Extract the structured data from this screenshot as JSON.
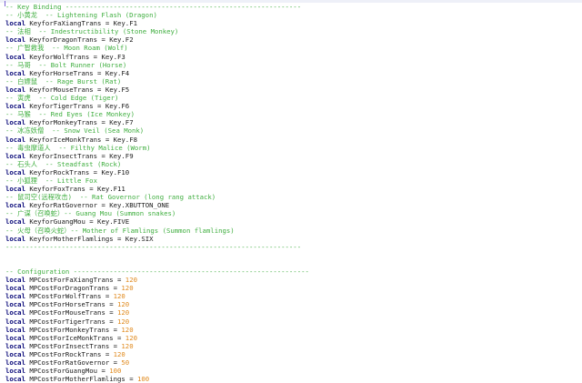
{
  "editor": {
    "key_binding": {
      "header": "-- Key Binding -----------------------------------------------------------",
      "entries": [
        {
          "comment": "-- 小黄龙  -- Lightening Flash (Dragon)",
          "keyword": "local",
          "code": " KeyforFaXiangTrans = Key.F1"
        },
        {
          "comment": "-- 法相  -- Indestructibility (Stone Monkey)",
          "keyword": "local",
          "code": " KeyforDragonTrans = Key.F2"
        },
        {
          "comment": "-- 广智救我  -- Moon Roam (Wolf)",
          "keyword": "local",
          "code": " KeyforWolfTrans = Key.F3"
        },
        {
          "comment": "-- 马哥  -- Bolt Runner (Horse)",
          "keyword": "local",
          "code": " KeyforHorseTrans = Key.F4"
        },
        {
          "comment": "-- 白嫖鼠  -- Rage Burst (Rat)",
          "keyword": "local",
          "code": " KeyforMouseTrans = Key.F5"
        },
        {
          "comment": "-- 寅虎  -- Cold Edge (Tiger)",
          "keyword": "local",
          "code": " KeyforTigerTrans = Key.F6"
        },
        {
          "comment": "-- 马猴  -- Red Eyes (Ice Monkey)",
          "keyword": "local",
          "code": " KeyforMonkeyTrans = Key.F7"
        },
        {
          "comment": "-- 冰冻妖僧  -- Snow Veil (Sea Monk)",
          "keyword": "local",
          "code": " KeyforIceMonkTrans = Key.F8"
        },
        {
          "comment": "-- 毒虫摩道人  -- Filthy Malice (Worm)",
          "keyword": "local",
          "code": " KeyforInsectTrans = Key.F9"
        },
        {
          "comment": "-- 石头人  -- Steadfast (Rock)",
          "keyword": "local",
          "code": " KeyforRockTrans = Key.F10"
        },
        {
          "comment": "-- 小狐狸  -- Little Fox",
          "keyword": "local",
          "code": " KeyforFoxTrans = Key.F11"
        },
        {
          "comment": "-- 鼠司空(远程攻击)  -- Rat Governor (long rang attack)",
          "keyword": "local",
          "code": " KeyforRatGovernor = Key.XBUTTON_ONE"
        },
        {
          "comment": "-- 广谋（召唤蛇）-- Guang Mou (Summon snakes)",
          "keyword": "local",
          "code": " KeyforGuangMou = Key.FIVE"
        },
        {
          "comment": "-- 火母（召唤火蛇）-- Mother of Flamlings (Summon flamlings)",
          "keyword": "local",
          "code": " KeyforMotherFlamlings = Key.SIX"
        }
      ],
      "footer": "--------------------------------------------------------------------------"
    },
    "configuration": {
      "header": "-- Configuration -----------------------------------------------------------",
      "entries": [
        {
          "keyword": "local",
          "name": " MPCostForFaXiangTrans = ",
          "value": "120"
        },
        {
          "keyword": "local",
          "name": " MPCostForDragonTrans = ",
          "value": "120"
        },
        {
          "keyword": "local",
          "name": " MPCostForWolfTrans = ",
          "value": "120"
        },
        {
          "keyword": "local",
          "name": " MPCostForHorseTrans = ",
          "value": "120"
        },
        {
          "keyword": "local",
          "name": " MPCostForMouseTrans = ",
          "value": "120"
        },
        {
          "keyword": "local",
          "name": " MPCostForTigerTrans = ",
          "value": "120"
        },
        {
          "keyword": "local",
          "name": " MPCostForMonkeyTrans = ",
          "value": "120"
        },
        {
          "keyword": "local",
          "name": " MPCostForIceMonkTrans = ",
          "value": "120"
        },
        {
          "keyword": "local",
          "name": " MPCostForInsectTrans = ",
          "value": "120"
        },
        {
          "keyword": "local",
          "name": " MPCostForRockTrans = ",
          "value": "120"
        },
        {
          "keyword": "local",
          "name": " MPCostForRatGovernor = ",
          "value": "50"
        },
        {
          "keyword": "local",
          "name": " MPCostForGuangMou = ",
          "value": "100"
        },
        {
          "keyword": "local",
          "name": " MPCostForMotherFlamlings = ",
          "value": "100"
        }
      ],
      "footer": "--------------------------------------------------------------------------"
    },
    "colors": {
      "comment": "#3fae3f",
      "keyword": "#0a0a7a",
      "number": "#e08a1e",
      "text": "#1a1a1a"
    }
  }
}
